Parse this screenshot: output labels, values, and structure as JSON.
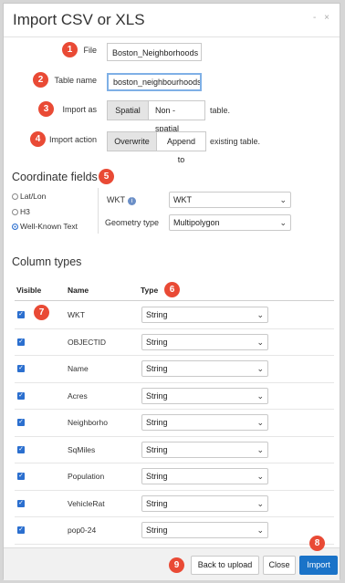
{
  "dialog": {
    "title": "Import CSV or XLS",
    "window_controls": "- ×"
  },
  "form": {
    "file_label": "File",
    "file_value": "Boston_Neighborhoods",
    "table_name_label": "Table name",
    "table_name_value": "boston_neighbourhoods",
    "import_as_label": "Import as",
    "import_as_options": [
      "Spatial",
      "Non - spatial"
    ],
    "import_as_selected": "Spatial",
    "import_as_suffix": "table.",
    "import_action_label": "Import action",
    "import_action_options": [
      "Overwrite",
      "Append to"
    ],
    "import_action_selected": "Overwrite",
    "import_action_suffix": "existing table."
  },
  "coordinate_fields": {
    "heading": "Coordinate fields",
    "radios": [
      "Lat/Lon",
      "H3",
      "Well-Known Text"
    ],
    "selected_radio": "Well-Known Text",
    "wkt_label": "WKT",
    "wkt_value": "WKT",
    "geometry_type_label": "Geometry type",
    "geometry_type_value": "Multipolygon"
  },
  "column_types": {
    "heading": "Column types",
    "headers": {
      "visible": "Visible",
      "name": "Name",
      "type": "Type"
    },
    "rows": [
      {
        "name": "WKT",
        "type": "String",
        "visible": true
      },
      {
        "name": "OBJECTID",
        "type": "String",
        "visible": true
      },
      {
        "name": "Name",
        "type": "String",
        "visible": true
      },
      {
        "name": "Acres",
        "type": "String",
        "visible": true
      },
      {
        "name": "Neighborho",
        "type": "String",
        "visible": true
      },
      {
        "name": "SqMiles",
        "type": "String",
        "visible": true
      },
      {
        "name": "Population",
        "type": "String",
        "visible": true
      },
      {
        "name": "VehicleRat",
        "type": "String",
        "visible": true
      },
      {
        "name": "pop0-24",
        "type": "String",
        "visible": true
      }
    ]
  },
  "footer": {
    "back_label": "Back to upload",
    "close_label": "Close",
    "import_label": "Import"
  },
  "callouts": [
    "1",
    "2",
    "3",
    "4",
    "5",
    "6",
    "7",
    "8",
    "9"
  ],
  "icons": {
    "checkbox": "checkmark-icon",
    "select": "chevron-down-icon",
    "info": "info-icon"
  },
  "colors": {
    "callout": "#e94a35",
    "primary": "#1a73c8",
    "checkbox": "#2b6fcf"
  }
}
